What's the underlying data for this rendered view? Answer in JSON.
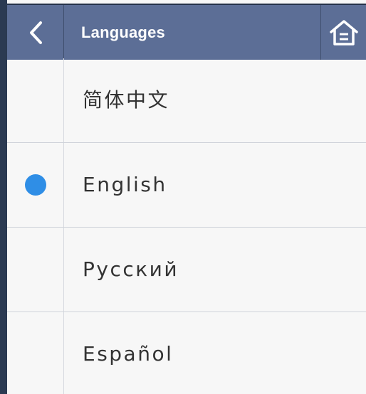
{
  "header": {
    "title": "Languages",
    "back_icon": "chevron-left-icon",
    "home_icon": "home-icon"
  },
  "languages": [
    {
      "label": "简体中文",
      "selected": false
    },
    {
      "label": "English",
      "selected": true
    },
    {
      "label": "Русский",
      "selected": false
    },
    {
      "label": "Español",
      "selected": false
    }
  ],
  "colors": {
    "header_bg": "#5c6e96",
    "selected_radio": "#2f8ee6",
    "text": "#333333"
  }
}
